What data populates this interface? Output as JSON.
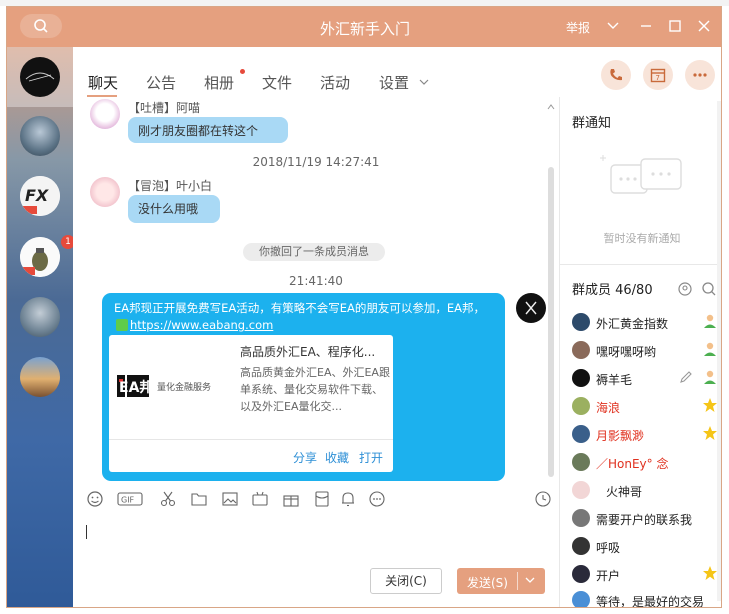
{
  "window": {
    "title": "外汇新手入门",
    "report": "举报"
  },
  "tabs": [
    {
      "label": "聊天"
    },
    {
      "label": "公告"
    },
    {
      "label": "相册"
    },
    {
      "label": "文件"
    },
    {
      "label": "活动"
    },
    {
      "label": "设置"
    }
  ],
  "sidebar": {
    "badge": "1"
  },
  "messages": {
    "m1": {
      "name": "【吐槽】阿喵",
      "text": "刚才朋友圈都在转这个"
    },
    "t1": "2018/11/19 14:27:41",
    "m2": {
      "name": "【冒泡】叶小白",
      "text": "没什么用哦"
    },
    "recall": "你撤回了一条成员消息",
    "t2": "21:41:40",
    "m3": {
      "text": "EA邦现正开展免费写EA活动，有策略不会写EA的朋友可以参加，EA邦，",
      "link": "https://www.eabang.com",
      "card": {
        "title": "高品质外汇EA、程序化...",
        "desc": "高品质黄金外汇EA、外汇EA跟单系统、量化交易软件下载、以及外汇EA量化交...",
        "logo_text": "EA邦",
        "logo_sub": "量化金融服务",
        "share": "分享",
        "favorite": "收藏",
        "open": "打开"
      }
    }
  },
  "input": {
    "close_label": "关闭(C)",
    "send_label": "发送(S)"
  },
  "notice": {
    "title": "群通知",
    "empty": "暂时没有新通知"
  },
  "members": {
    "title": "群成员 46/80",
    "list": [
      {
        "name": "外汇黄金指数",
        "red": false
      },
      {
        "name": "嘿呀嘿呀哟",
        "red": false
      },
      {
        "name": "褥羊毛",
        "red": false
      },
      {
        "name": "海浪",
        "red": true
      },
      {
        "name": "月影飘渺",
        "red": true
      },
      {
        "name": "／HonEy° 念",
        "red": true
      },
      {
        "name": "火神哥",
        "red": false
      },
      {
        "name": "需要开户的联系我",
        "red": false
      },
      {
        "name": "呼吸",
        "red": false
      },
      {
        "name": "开户",
        "red": false
      },
      {
        "name": "等待，是最好的交易",
        "red": false
      }
    ]
  },
  "colors": {
    "accent": "#e5a07f",
    "bubble": "#a9d9f5",
    "ea_bubble": "#1cb1ee",
    "red_name": "#e0311f"
  }
}
